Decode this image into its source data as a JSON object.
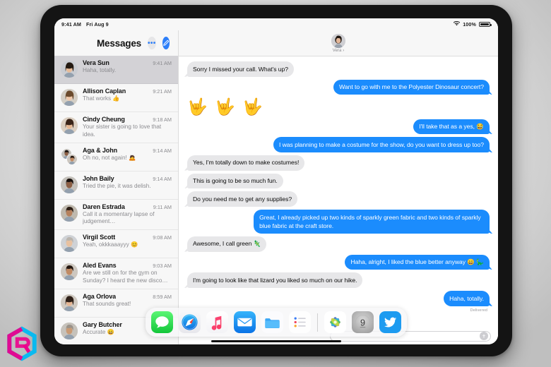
{
  "statusbar": {
    "time": "9:41 AM",
    "date": "Fri Aug 9",
    "wifi_icon": "wifi-icon",
    "battery_percent": "100%",
    "battery_icon": "battery-full-icon"
  },
  "sidebar": {
    "title": "Messages",
    "more_button_label": "•••",
    "more_icon": "ellipsis-icon",
    "compose_icon": "compose-icon",
    "conversations": [
      {
        "name": "Vera Sun",
        "time": "9:41 AM",
        "preview": "Haha, totally.",
        "selected": true,
        "group": false
      },
      {
        "name": "Allison Caplan",
        "time": "9:21 AM",
        "preview": "That works 👍",
        "selected": false,
        "group": false
      },
      {
        "name": "Cindy Cheung",
        "time": "9:18 AM",
        "preview": "Your sister is going to love that idea.",
        "selected": false,
        "group": false
      },
      {
        "name": "Aga & John",
        "time": "9:14 AM",
        "preview": "Oh no, not again! 🙇",
        "selected": false,
        "group": true
      },
      {
        "name": "John Baily",
        "time": "9:14 AM",
        "preview": "Tried the pie, it was delish.",
        "selected": false,
        "group": false
      },
      {
        "name": "Daren Estrada",
        "time": "9:11 AM",
        "preview": "Call it a momentary lapse of judgement…",
        "selected": false,
        "group": false
      },
      {
        "name": "Virgil Scott",
        "time": "9:08 AM",
        "preview": "Yeah, okkkaaayyy 😊",
        "selected": false,
        "group": false
      },
      {
        "name": "Aled Evans",
        "time": "9:03 AM",
        "preview": "Are we still on for the gym on Sunday? I heard the new disco…",
        "selected": false,
        "group": false
      },
      {
        "name": "Aga Orlova",
        "time": "8:59 AM",
        "preview": "That sounds great!",
        "selected": false,
        "group": false
      },
      {
        "name": "Gary Butcher",
        "time": "",
        "preview": "Accurate 😄",
        "selected": false,
        "group": false
      }
    ]
  },
  "thread": {
    "contact_name": "Vera ›",
    "avatar_icon": "contact-avatar",
    "messages": [
      {
        "side": "in",
        "text": "Sorry I missed your call. What's up?"
      },
      {
        "side": "out",
        "text": "Want to go with me to the Polyester Dinosaur concert?"
      },
      {
        "side": "emoji",
        "text": "🤟 🤟 🤟"
      },
      {
        "side": "out",
        "text": "I'll take that as a yes, 😂"
      },
      {
        "side": "out",
        "text": "I was planning to make a costume for the show, do you want to dress up too?"
      },
      {
        "side": "in",
        "text": "Yes, I'm totally down to make costumes!"
      },
      {
        "side": "in",
        "text": "This is going to be so much fun."
      },
      {
        "side": "in",
        "text": "Do you need me to get any supplies?"
      },
      {
        "side": "out",
        "text": "Great, I already picked up two kinds of sparkly green fabric and two kinds of sparkly blue fabric at the craft store."
      },
      {
        "side": "in",
        "text": "Awesome, I call green 🦎"
      },
      {
        "side": "out",
        "text": "Haha, alright, I liked the blue better anyway 😄 🦕"
      },
      {
        "side": "in",
        "text": "I'm going to look like that lizard you liked so much on our hike."
      },
      {
        "side": "out",
        "text": "Haha, totally."
      }
    ],
    "delivered_label": "Delivered"
  },
  "compose": {
    "placeholder": "",
    "value": "",
    "send_icon": "send-arrow-icon"
  },
  "dock": {
    "items": [
      {
        "name": "messages",
        "label": "Messages"
      },
      {
        "name": "safari",
        "label": "Safari"
      },
      {
        "name": "music",
        "label": "Music"
      },
      {
        "name": "mail",
        "label": "Mail"
      },
      {
        "name": "files",
        "label": "Files"
      },
      {
        "name": "reminders",
        "label": "Reminders"
      },
      {
        "name": "photos",
        "label": "Photos"
      },
      {
        "name": "clock",
        "label": "Clock"
      },
      {
        "name": "twitter",
        "label": "Twitter"
      }
    ],
    "clock_number": "9"
  },
  "colors": {
    "imessage_blue": "#1b8cfd",
    "bubble_gray": "#e7e7e9",
    "sidebar_bg": "#f7f7f7",
    "selected_row": "#d3d2d6",
    "accent_blue": "#2d7ff9",
    "watermark_magenta": "#ec008c",
    "watermark_cyan": "#00b9f2"
  },
  "watermark": {
    "icon": "hexagon-logo-watermark"
  }
}
